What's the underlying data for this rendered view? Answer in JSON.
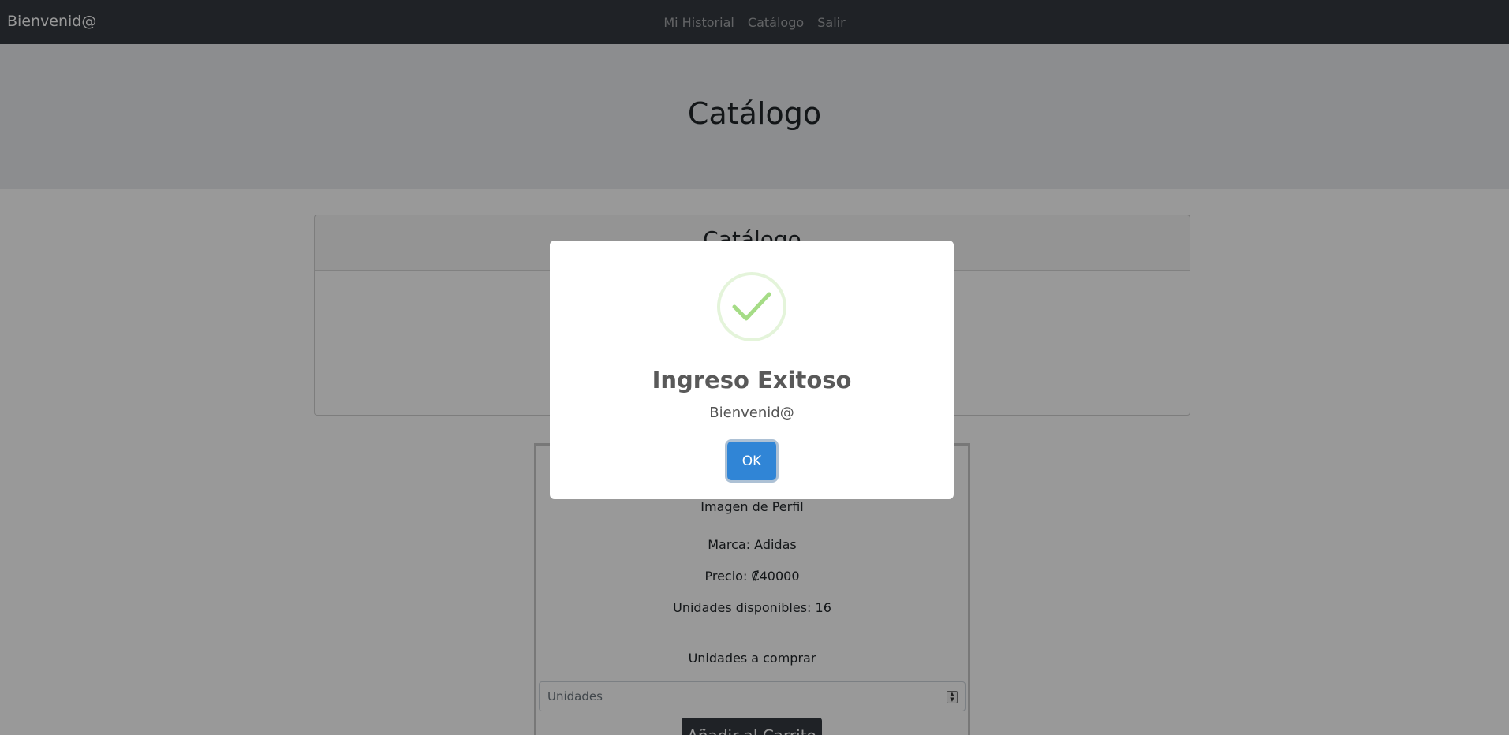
{
  "navbar": {
    "brand": "Bienvenid@",
    "links": [
      "Mi Historial",
      "Catálogo",
      "Salir"
    ]
  },
  "jumbotron": {
    "title": "Catálogo"
  },
  "card": {
    "header": "Catálogo"
  },
  "product": {
    "image_label": "Imagen de Perfil",
    "brand": "Marca: Adidas",
    "price": "Precio: ₡40000",
    "stock": "Unidades disponibles: 16",
    "qty_label": "Unidades a comprar",
    "qty_placeholder": "Unidades",
    "add_button": "Añadir al Carrito"
  },
  "modal": {
    "icon": "checkmark-icon",
    "title": "Ingreso Exitoso",
    "text": "Bienvenid@",
    "ok_button": "OK"
  },
  "colors": {
    "navbar": "#343a40",
    "jumbotron": "#e9ecef",
    "ok_button": "#3085d6",
    "success_check": "#a5dc86"
  }
}
